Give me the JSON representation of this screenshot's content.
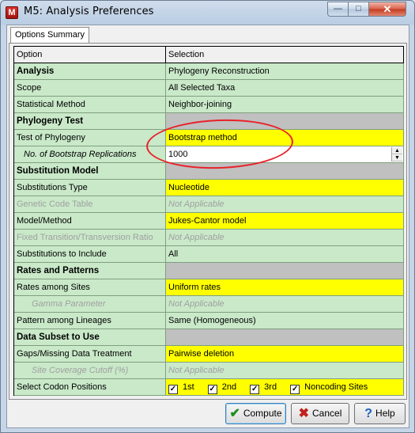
{
  "window": {
    "title": "M5: Analysis Preferences",
    "icon_letter": "M",
    "buttons": {
      "minimize": "—",
      "maximize": "□",
      "close": "✕"
    }
  },
  "tab": {
    "label": "Options Summary"
  },
  "table": {
    "headers": {
      "option": "Option",
      "selection": "Selection"
    },
    "rows": [
      {
        "option": "Analysis",
        "selection": "Phylogeny Reconstruction"
      },
      {
        "option": "Scope",
        "selection": "All Selected Taxa"
      },
      {
        "option": "Statistical Method",
        "selection": "Neighbor-joining"
      },
      {
        "option": "Phylogeny Test",
        "selection": ""
      },
      {
        "option": "Test of Phylogeny",
        "selection": "Bootstrap method"
      },
      {
        "option": "No. of Bootstrap Replications",
        "selection": "1000"
      },
      {
        "option": "Substitution Model",
        "selection": ""
      },
      {
        "option": "Substitutions Type",
        "selection": "Nucleotide"
      },
      {
        "option": "Genetic Code Table",
        "selection": "Not Applicable"
      },
      {
        "option": "Model/Method",
        "selection": "Jukes-Cantor model"
      },
      {
        "option": "Fixed Transition/Transversion Ratio",
        "selection": "Not Applicable"
      },
      {
        "option": "Substitutions to Include",
        "selection": "All"
      },
      {
        "option": "Rates and Patterns",
        "selection": ""
      },
      {
        "option": "Rates among Sites",
        "selection": "Uniform rates"
      },
      {
        "option": "Gamma Parameter",
        "selection": "Not Applicable"
      },
      {
        "option": "Pattern among Lineages",
        "selection": "Same (Homogeneous)"
      },
      {
        "option": "Data Subset to Use",
        "selection": ""
      },
      {
        "option": "Gaps/Missing Data Treatment",
        "selection": "Pairwise deletion"
      },
      {
        "option": "Site Coverage Cutoff (%)",
        "selection": "Not Applicable"
      },
      {
        "option": "Select Codon Positions",
        "selection": ""
      }
    ],
    "codon_positions": [
      {
        "label": "1st",
        "checked": true
      },
      {
        "label": "2nd",
        "checked": true
      },
      {
        "label": "3rd",
        "checked": true
      },
      {
        "label": "Noncoding Sites",
        "checked": true
      }
    ]
  },
  "footer": {
    "compute": "Compute",
    "cancel": "Cancel",
    "help": "Help"
  },
  "colors": {
    "row_green": "#c9e9c9",
    "highlight_yellow": "#ffff00",
    "section_gray": "#c0c0c0",
    "annotation_red": "#e8222a"
  }
}
